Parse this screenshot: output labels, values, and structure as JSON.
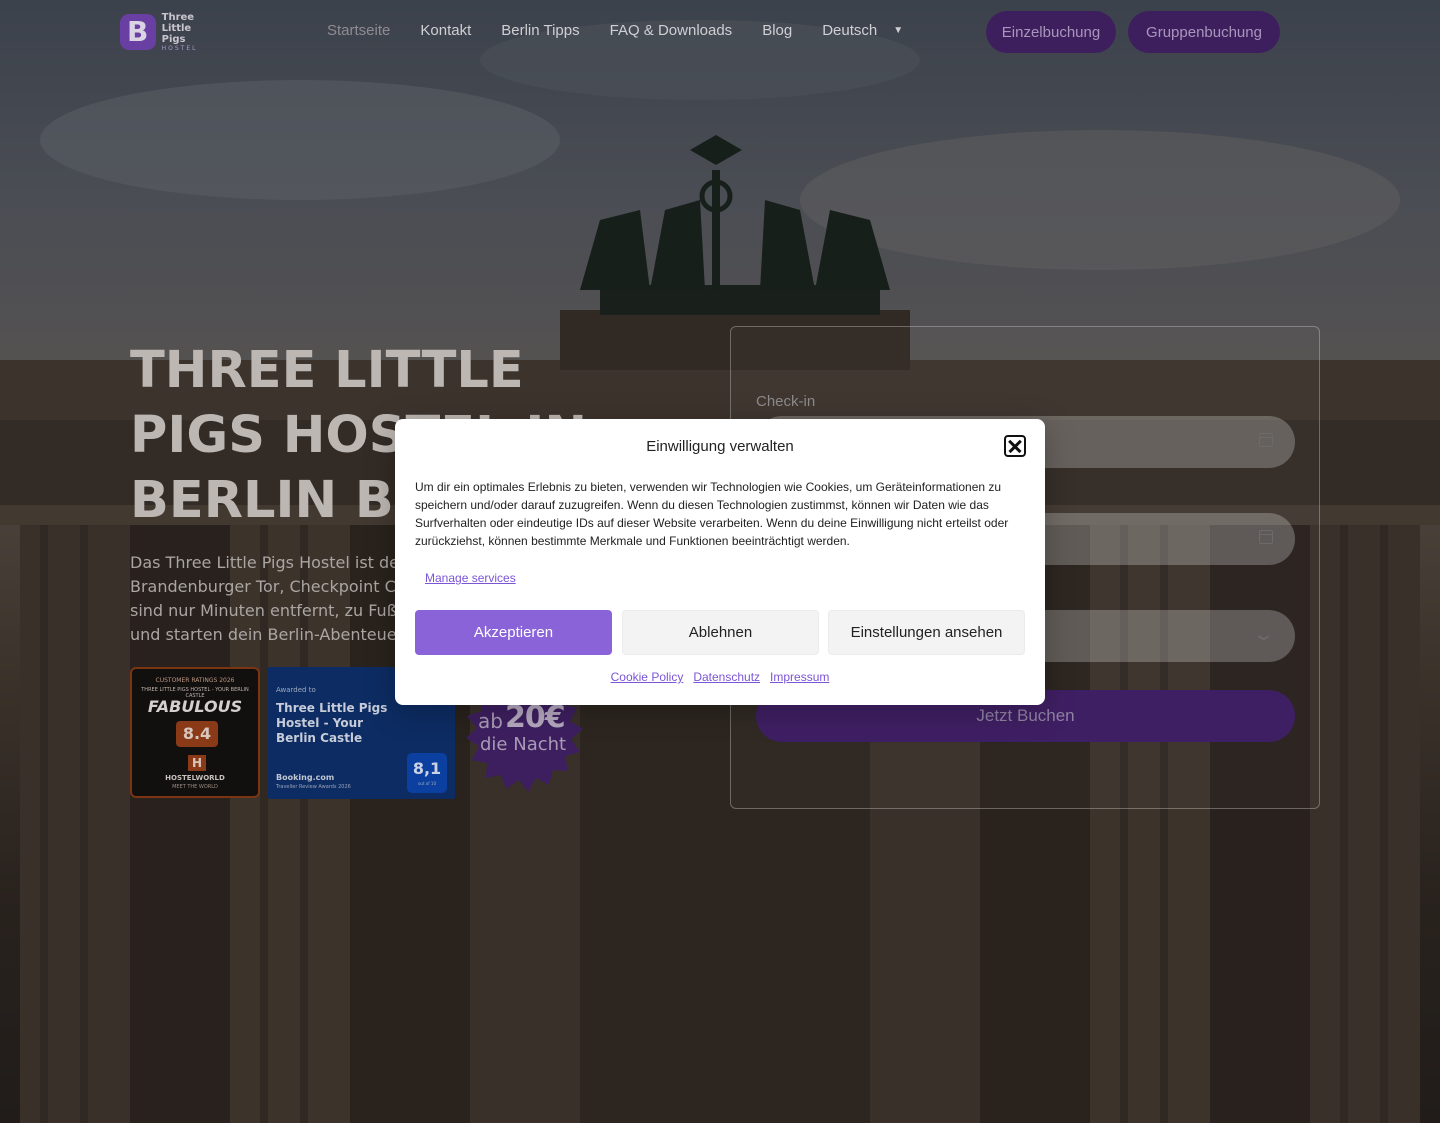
{
  "header": {
    "logo": {
      "line1": "Three",
      "line2": "Little Pigs",
      "line3": "HOSTEL"
    },
    "nav": [
      {
        "label": "Startseite"
      },
      {
        "label": "Kontakt"
      },
      {
        "label": "Berlin Tipps"
      },
      {
        "label": "FAQ & Downloads"
      },
      {
        "label": "Blog"
      },
      {
        "label": "Deutsch"
      }
    ],
    "buttons": {
      "single": "Einzelbuchung",
      "group": "Gruppenbuchung"
    }
  },
  "hero": {
    "title": "Three Little Pigs Hostel in Berlin buchen",
    "description": "Das Three Little Pigs Hostel ist dein Brandenburger Tor, Checkpoint C sind nur Minuten entfernt, zu Fuß o und starten dein Berlin-Abenteue",
    "hostelworld_badge": {
      "top": "CUSTOMER RATINGS 2026",
      "subtop": "THREE LITTLE PIGS HOSTEL - YOUR BERLIN CASTLE",
      "award": "FABULOUS",
      "score": "8.4",
      "mark": "H",
      "brand": "HOSTELWORLD",
      "tagline": "MEET THE WORLD"
    },
    "booking_badge": {
      "awarded": "Awarded to",
      "name": "Three Little Pigs Hostel - Your Berlin Castle",
      "brand": "Booking.com",
      "award": "Traveller Review Awards 2026",
      "score": "8,1",
      "out_of": "out of 10"
    },
    "price": {
      "prefix": "ab",
      "amount": "20€",
      "suffix": "die Nacht"
    }
  },
  "booking_form": {
    "checkin_label": "Check-in",
    "submit": "Jetzt Buchen"
  },
  "consent": {
    "title": "Einwilligung verwalten",
    "body": "Um dir ein optimales Erlebnis zu bieten, verwenden wir Technologien wie Cookies, um Geräteinformationen zu speichern und/oder darauf zuzugreifen. Wenn du diesen Technologien zustimmst, können wir Daten wie das Surfverhalten oder eindeutige IDs auf dieser Website verarbeiten. Wenn du deine Einwilligung nicht erteilst oder zurückziehst, können bestimmte Merkmale und Funktionen beeinträchtigt werden.",
    "manage": "Manage services",
    "accept": "Akzeptieren",
    "deny": "Ablehnen",
    "settings": "Einstellungen ansehen",
    "links": [
      "Cookie Policy",
      "Datenschutz",
      "Impressum"
    ]
  },
  "colors": {
    "accent": "#8a63d9",
    "brand_purple": "#3e1f5e",
    "modal_bg": "#ffffff"
  }
}
